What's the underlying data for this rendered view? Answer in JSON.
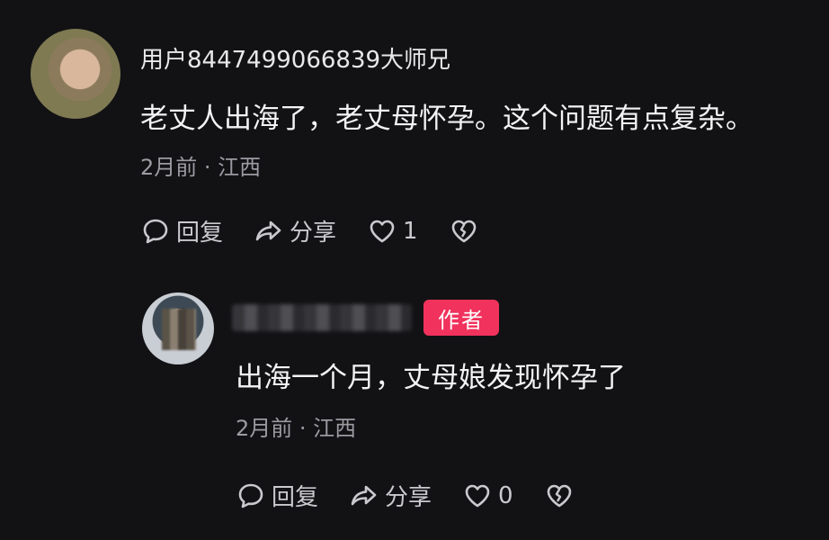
{
  "comment": {
    "username": "用户8447499066839大师兄",
    "text": "老丈人出海了，老丈母怀孕。这个问题有点复杂。",
    "meta": "2月前 · 江西",
    "actions": {
      "reply_label": "回复",
      "share_label": "分享",
      "like_count": "1"
    }
  },
  "reply": {
    "badge": "作者",
    "text": "出海一个月，丈母娘发现怀孕了",
    "meta": "2月前 · 江西",
    "actions": {
      "reply_label": "回复",
      "share_label": "分享",
      "like_count": "0"
    }
  },
  "colors": {
    "background": "#121214",
    "badge": "#f0325c",
    "meta_text": "#9b9ba2"
  }
}
